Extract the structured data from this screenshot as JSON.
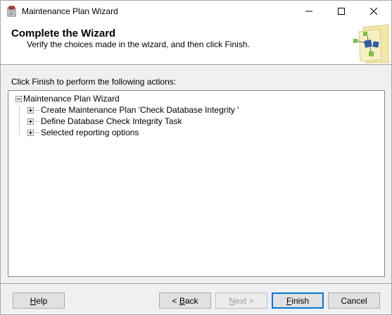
{
  "window": {
    "title": "Maintenance Plan Wizard",
    "icon": "wizard-app-icon",
    "caption_buttons": [
      "minimize-icon",
      "maximize-icon",
      "close-icon"
    ]
  },
  "header": {
    "title": "Complete the Wizard",
    "subtitle": "Verify the choices made in the wizard, and then click Finish."
  },
  "instruction": "Click Finish to perform the following actions:",
  "tree": {
    "root": "Maintenance Plan Wizard",
    "children": [
      "Create Maintenance Plan 'Check Database Integrity '",
      "Define Database Check Integrity Task",
      "Selected reporting options"
    ]
  },
  "buttons": {
    "help_pre": "",
    "help_key": "H",
    "help_post": "elp",
    "back_pre": "< ",
    "back_key": "B",
    "back_post": "ack",
    "next_pre": "",
    "next_key": "N",
    "next_post": "ext >",
    "finish_pre": "",
    "finish_key": "F",
    "finish_post": "inish",
    "cancel": "Cancel"
  },
  "colors": {
    "accent": "#0078d7",
    "dialog_bg": "#f0f0f0",
    "disabled_text": "#a0a0a0"
  }
}
